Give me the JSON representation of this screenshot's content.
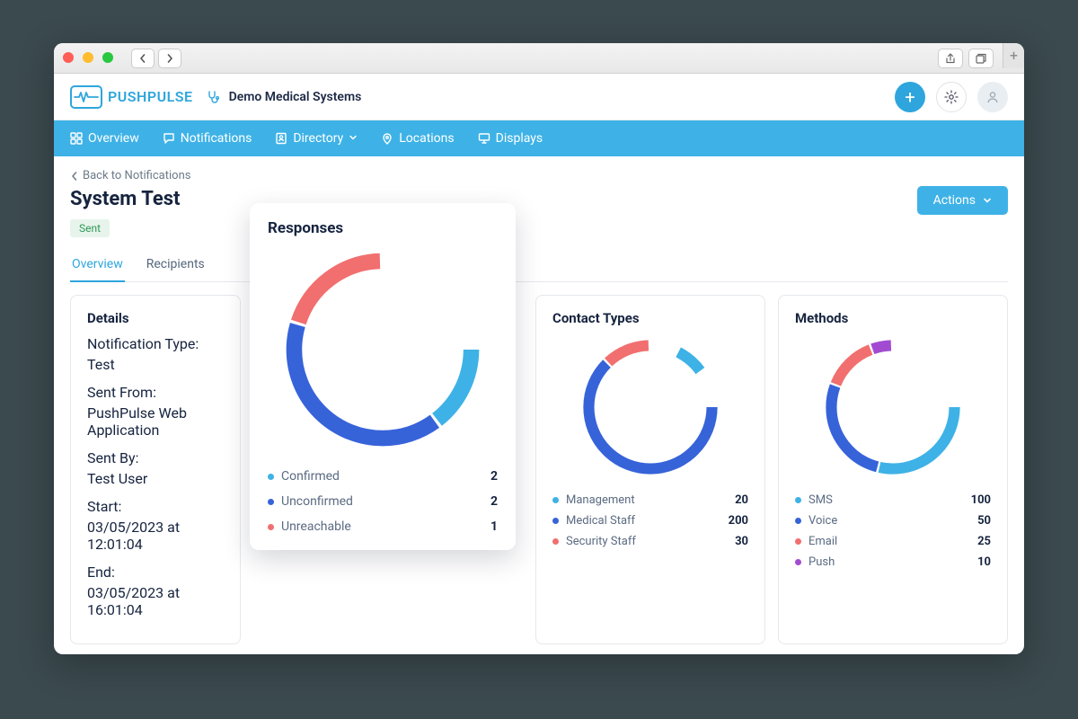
{
  "browser": {},
  "header": {
    "brand": "PUSHPULSE",
    "org": "Demo Medical Systems"
  },
  "nav": {
    "items": [
      {
        "label": "Overview"
      },
      {
        "label": "Notifications"
      },
      {
        "label": "Directory"
      },
      {
        "label": "Locations"
      },
      {
        "label": "Displays"
      }
    ]
  },
  "page": {
    "back": "Back to Notifications",
    "title": "System Test",
    "status": "Sent",
    "actions_label": "Actions",
    "tabs": {
      "overview": "Overview",
      "recipients": "Recipients"
    }
  },
  "details": {
    "title": "Details",
    "notification_type_label": "Notification Type",
    "notification_type_value": "Test",
    "sent_from_label": "Sent From",
    "sent_from_value": "PushPulse Web Application",
    "sent_by_label": "Sent By",
    "sent_by_value": "Test User",
    "start_label": "Start",
    "start_value": "03/05/2023 at 12:01:04",
    "end_label": "End",
    "end_value": "03/05/2023 at 16:01:04"
  },
  "responses": {
    "title": "Responses",
    "items": [
      {
        "label": "Confirmed",
        "value": 2,
        "color": "#3eb2e6"
      },
      {
        "label": "Unconfirmed",
        "value": 2,
        "color": "#3763d9"
      },
      {
        "label": "Unreachable",
        "value": 1,
        "color": "#f16f6f"
      }
    ]
  },
  "contact_types": {
    "title": "Contact Types",
    "items": [
      {
        "label": "Management",
        "value": 20,
        "color": "#3eb2e6"
      },
      {
        "label": "Medical Staff",
        "value": 200,
        "color": "#3763d9"
      },
      {
        "label": "Security Staff",
        "value": 30,
        "color": "#f16f6f"
      }
    ]
  },
  "methods": {
    "title": "Methods",
    "items": [
      {
        "label": "SMS",
        "value": 100,
        "color": "#3eb2e6"
      },
      {
        "label": "Voice",
        "value": 50,
        "color": "#3763d9"
      },
      {
        "label": "Email",
        "value": 25,
        "color": "#f16f6f"
      },
      {
        "label": "Push",
        "value": 10,
        "color": "#a24bd1"
      }
    ]
  },
  "chart_data": [
    {
      "type": "pie",
      "title": "Responses",
      "series": [
        {
          "name": "Confirmed",
          "value": 2
        },
        {
          "name": "Unconfirmed",
          "value": 2
        },
        {
          "name": "Unreachable",
          "value": 1
        }
      ]
    },
    {
      "type": "pie",
      "title": "Contact Types",
      "series": [
        {
          "name": "Management",
          "value": 20
        },
        {
          "name": "Medical Staff",
          "value": 200
        },
        {
          "name": "Security Staff",
          "value": 30
        }
      ]
    },
    {
      "type": "pie",
      "title": "Methods",
      "series": [
        {
          "name": "SMS",
          "value": 100
        },
        {
          "name": "Voice",
          "value": 50
        },
        {
          "name": "Email",
          "value": 25
        },
        {
          "name": "Push",
          "value": 10
        }
      ]
    }
  ]
}
